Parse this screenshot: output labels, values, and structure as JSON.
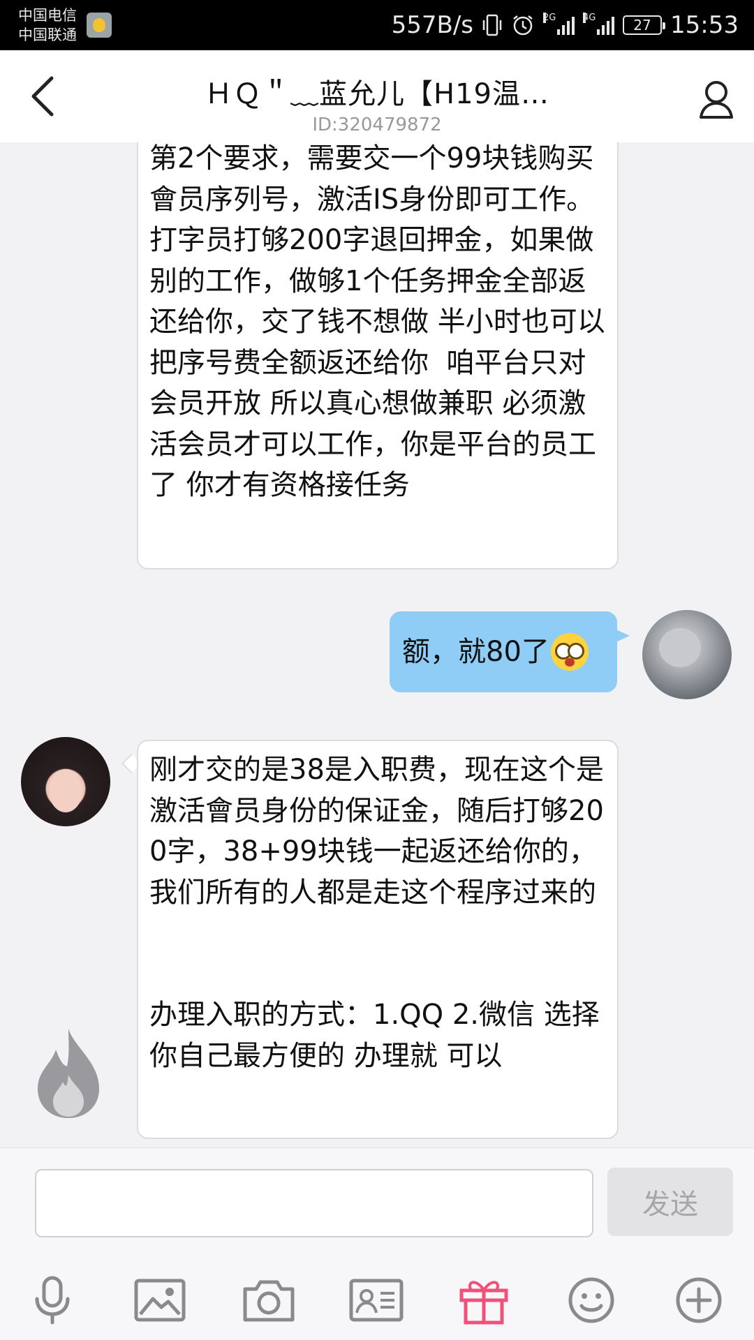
{
  "status_bar": {
    "carrier_1": "中国电信",
    "carrier_2": "中国联通",
    "net_speed": "557B/s",
    "network_1": "2G",
    "network_2": "4G",
    "battery": "27",
    "time": "15:53"
  },
  "header": {
    "title": "ＨＱ＂﹏蓝允儿【H19温…",
    "subtitle": "ID:320479872"
  },
  "messages": [
    {
      "sender": "peer",
      "text": "第2个要求，需要交一个99块钱购买會员序列号，激活IS身份即可工作。打字员打够200字退回押金，如果做别的工作，做够1个任务押金全部返还给你，交了钱不想做 半小时也可以把序号费全额返还给你  咱平台只对会员开放 所以真心想做兼职 必须激活会员才可以工作，你是平台的员工了 你才有资格接任务"
    },
    {
      "sender": "me",
      "text": "额，就80了",
      "emoji": "shocked-face-emoji"
    },
    {
      "sender": "peer",
      "text": "刚才交的是38是入职费，现在这个是激活會员身份的保证金，随后打够200字，38+99块钱一起返还给你的，我们所有的人都是走这个程序过来的\n\n\n办理入职的方式：1.QQ 2.微信 选择你自己最方便的 办理就 可以"
    }
  ],
  "input": {
    "value": "",
    "send_label": "发送"
  },
  "toolbar": [
    "microphone-icon",
    "image-icon",
    "camera-icon",
    "contact-card-icon",
    "gift-icon",
    "emoji-icon",
    "plus-icon"
  ],
  "colors": {
    "my_bubble": "#8fcdf6",
    "gift_accent": "#f0507a",
    "icon_gray": "#8a8a8e"
  }
}
